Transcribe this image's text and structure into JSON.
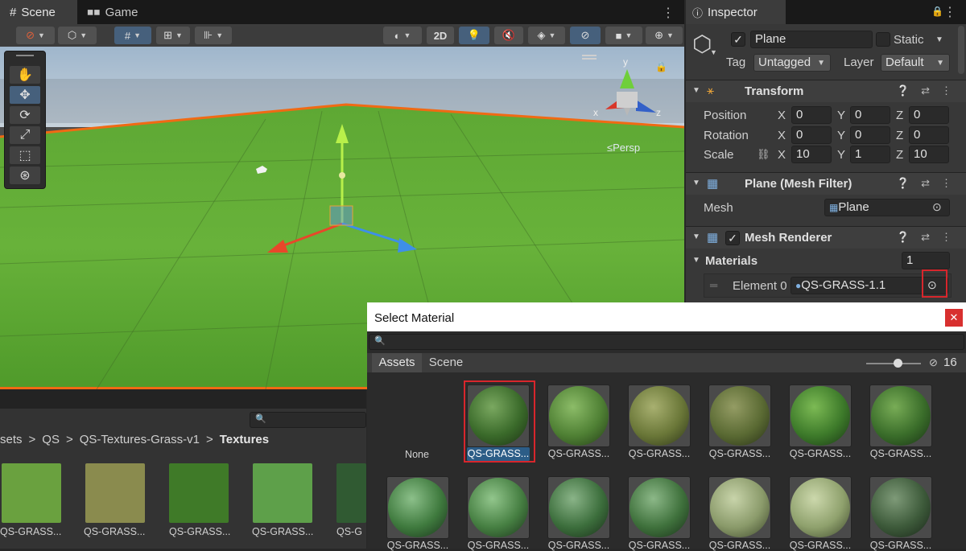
{
  "scene_tabs": [
    {
      "label": "Scene",
      "glyph": "#"
    },
    {
      "label": "Game",
      "glyph": "◼◼"
    }
  ],
  "toolbar": {
    "mode_2d": "2D"
  },
  "gizmo": {
    "axis_y": "y",
    "axis_x": "x",
    "axis_z": "z",
    "view_label": "≤Persp"
  },
  "inspector": {
    "tab_label": "Inspector",
    "object_name": "Plane",
    "static_label": "Static",
    "tag_label": "Tag",
    "tag_value": "Untagged",
    "layer_label": "Layer",
    "layer_value": "Default",
    "transform": {
      "title": "Transform",
      "position_label": "Position",
      "rotation_label": "Rotation",
      "scale_label": "Scale",
      "position": {
        "x": "0",
        "y": "0",
        "z": "0"
      },
      "rotation": {
        "x": "0",
        "y": "0",
        "z": "0"
      },
      "scale": {
        "x": "10",
        "y": "1",
        "z": "10"
      },
      "axis_x": "X",
      "axis_y": "Y",
      "axis_z": "Z"
    },
    "mesh_filter": {
      "title": "Plane (Mesh Filter)",
      "mesh_label": "Mesh",
      "mesh_value": "Plane"
    },
    "mesh_renderer": {
      "title": "Mesh Renderer",
      "materials_label": "Materials",
      "materials_count": "1",
      "element_label": "Element 0",
      "element_value": "QS-GRASS-1.1"
    }
  },
  "project": {
    "breadcrumb": [
      {
        "label": "sets"
      },
      {
        "label": "QS"
      },
      {
        "label": "QS-Textures-Grass-v1"
      },
      {
        "label": "Textures"
      }
    ],
    "separator": ">",
    "textures": [
      {
        "label": "QS-GRASS...",
        "color": "#6aa13f"
      },
      {
        "label": "QS-GRASS...",
        "color": "#8a8b4e"
      },
      {
        "label": "QS-GRASS...",
        "color": "#3f7a28"
      },
      {
        "label": "QS-GRASS...",
        "color": "#5ea04a"
      },
      {
        "label": "QS-G",
        "color": "#305a32"
      }
    ]
  },
  "dialog": {
    "title": "Select Material",
    "close_glyph": "✕",
    "tabs": [
      "Assets",
      "Scene"
    ],
    "hidden_count": "16",
    "none_label": "None",
    "row1": [
      {
        "label": "QS-GRASS...",
        "color": "#3a6a2a",
        "selected": true
      },
      {
        "label": "QS-GRASS...",
        "color": "#4f8034"
      },
      {
        "label": "QS-GRASS...",
        "color": "#6a7738"
      },
      {
        "label": "QS-GRASS...",
        "color": "#5a6a33"
      },
      {
        "label": "QS-GRASS...",
        "color": "#3d7a2a"
      },
      {
        "label": "QS-GRASS...",
        "color": "#3a6d2a"
      }
    ],
    "row2": [
      {
        "label": "QS-GRASS...",
        "color": "#3f7a3e"
      },
      {
        "label": "QS-GRASS...",
        "color": "#467f42"
      },
      {
        "label": "QS-GRASS...",
        "color": "#3c6e3c"
      },
      {
        "label": "QS-GRASS...",
        "color": "#3f713c"
      },
      {
        "label": "QS-GRASS...",
        "color": "#8a9a6a"
      },
      {
        "label": "QS-GRASS...",
        "color": "#8fa16d"
      },
      {
        "label": "QS-GRASS...",
        "color": "#3d5a3a"
      }
    ]
  },
  "colors": {
    "accent": "#46607c",
    "highlight": "#d8262c",
    "selection": "#2c5d87"
  }
}
